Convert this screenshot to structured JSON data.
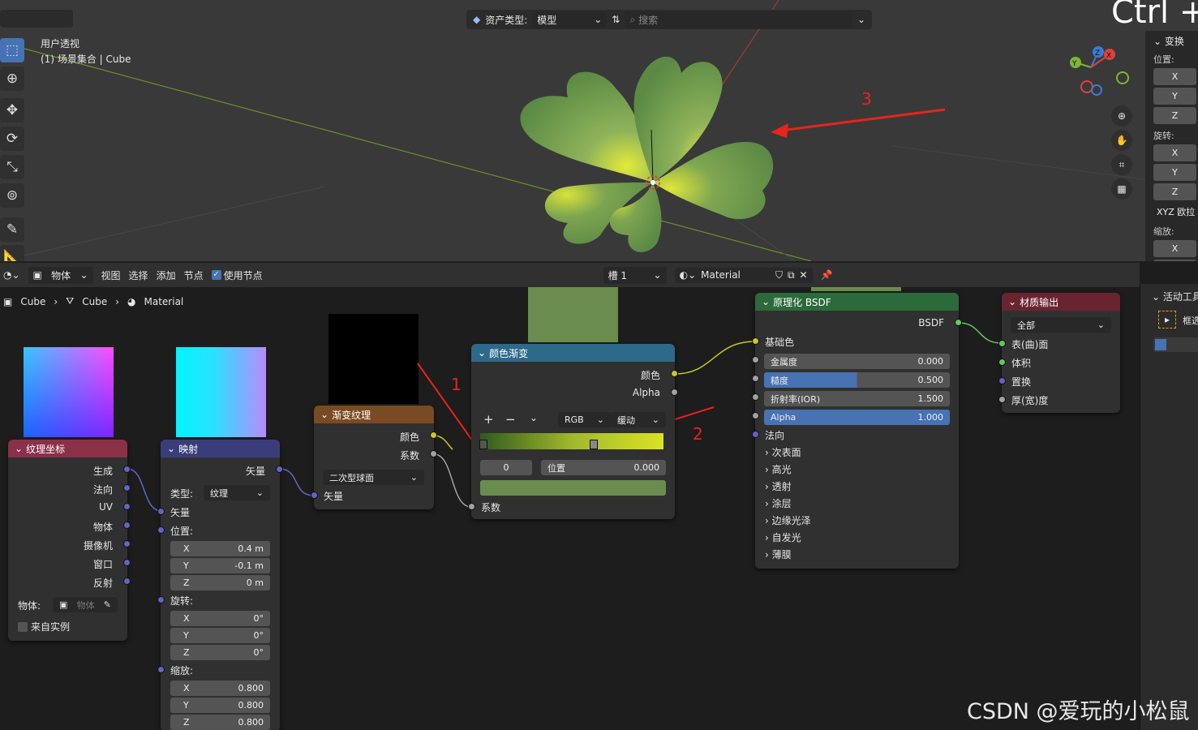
{
  "viewport": {
    "view_name": "用户透视",
    "collection": "(1) 场景集合 | Cube",
    "asset_type_label": "资产类型:",
    "asset_type_value": "模型",
    "search_placeholder": "搜索",
    "overlay_text": "Ctrl +",
    "annotation_3": "3",
    "gizmo_y": "Y",
    "gizmo_z": "Z",
    "gizmo_x": "X"
  },
  "npanel": {
    "section": "变换",
    "location_label": "位置:",
    "rotation_label": "旋转:",
    "scale_label": "缩放:",
    "x": "X",
    "y": "Y",
    "z": "Z",
    "euler": "XYZ 欧拉"
  },
  "node_header": {
    "mode": "物体",
    "menus": [
      "视图",
      "选择",
      "添加",
      "节点"
    ],
    "use_nodes": "使用节点",
    "slot": "槽 1",
    "material": "Material"
  },
  "breadcrumb": [
    "Cube",
    "Cube",
    "Material"
  ],
  "nodes": {
    "texcoord": {
      "title": "纹理坐标",
      "outputs": [
        "生成",
        "法向",
        "UV",
        "物体",
        "摄像机",
        "窗口",
        "反射"
      ],
      "object_label": "物体:",
      "object_placeholder": "物体",
      "from_instancer": "来自实例"
    },
    "mapping": {
      "title": "映射",
      "output": "矢量",
      "type_label": "类型:",
      "type_value": "纹理",
      "vector": "矢量",
      "location": "位置:",
      "loc": [
        [
          "X",
          "0.4 m"
        ],
        [
          "Y",
          "-0.1 m"
        ],
        [
          "Z",
          "0 m"
        ]
      ],
      "rotation": "旋转:",
      "rot": [
        [
          "X",
          "0°"
        ],
        [
          "Y",
          "0°"
        ],
        [
          "Z",
          "0°"
        ]
      ],
      "scale": "缩放:",
      "scl": [
        [
          "X",
          "0.800"
        ],
        [
          "Y",
          "0.800"
        ],
        [
          "Z",
          "0.800"
        ]
      ]
    },
    "gradient": {
      "title": "渐变纹理",
      "out_color": "颜色",
      "out_fac": "系数",
      "type": "二次型球面",
      "vector": "矢量"
    },
    "ramp": {
      "title": "颜色渐变",
      "out_color": "颜色",
      "out_alpha": "Alpha",
      "mode": "RGB",
      "interp": "缓动",
      "index": "0",
      "pos_label": "位置",
      "pos_value": "0.000",
      "fac": "系数",
      "annotation_1": "1",
      "annotation_2": "2"
    },
    "bsdf": {
      "title": "原理化 BSDF",
      "out": "BSDF",
      "base_color": "基础色",
      "fields": [
        [
          "金属度",
          "0.000",
          0
        ],
        [
          "糙度",
          "0.500",
          0.5
        ],
        [
          "折射率(IOR)",
          "1.500",
          0
        ],
        [
          "Alpha",
          "1.000",
          1
        ]
      ],
      "normal": "法向",
      "panels": [
        "次表面",
        "高光",
        "透射",
        "涂层",
        "边缘光泽",
        "自发光",
        "薄膜"
      ]
    },
    "output": {
      "title": "材质输出",
      "target": "全部",
      "inputs": [
        "表(曲)面",
        "体积",
        "置换",
        "厚(宽)度"
      ]
    }
  },
  "sidebar": {
    "title": "活动工具",
    "tool": "框选"
  },
  "watermark": "CSDN @爱玩的小松鼠",
  "colors": {
    "ramp_left": "#2f5a1e",
    "ramp_right": "#d9e226",
    "ramp_preview": "#6a8c4e",
    "accent": "#4772b3",
    "annotation": "#e8231c"
  }
}
